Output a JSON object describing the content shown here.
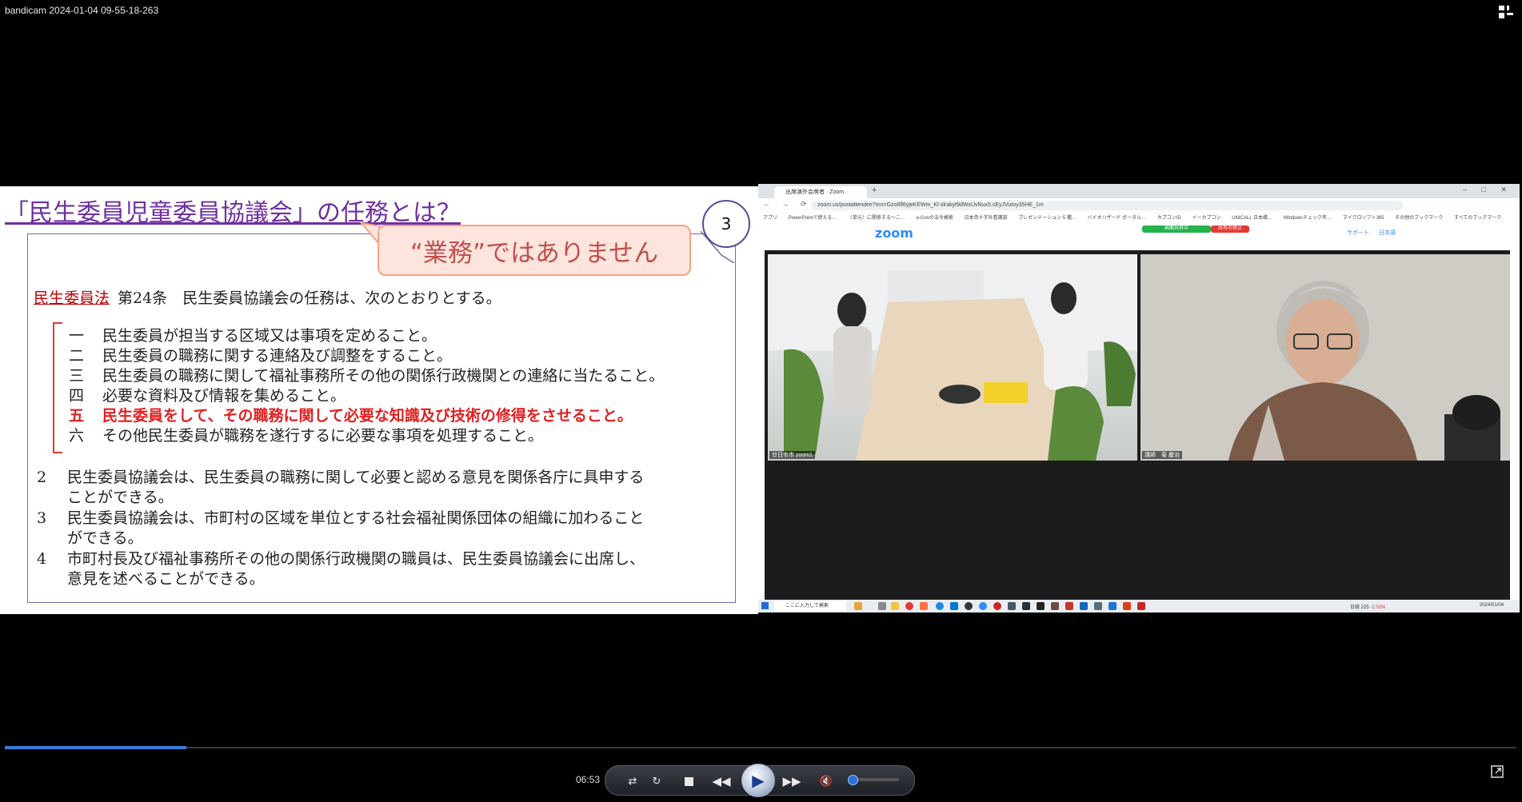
{
  "window": {
    "title": "bandicam 2024-01-04 09-55-18-263"
  },
  "slide": {
    "title": "「民生委員児童委員協議会」の任務とは？",
    "page_number": "3",
    "callout": "“業務”ではありません",
    "law_name": "民生委員法",
    "law_text": "第24条　民生委員協議会の任務は、次のとおりとする。",
    "items": [
      {
        "num": "一",
        "text": "民生委員が担当する区域又は事項を定めること。"
      },
      {
        "num": "二",
        "text": "民生委員の職務に関する連絡及び調整をすること。"
      },
      {
        "num": "三",
        "text": "民生委員の職務に関して福祉事務所その他の関係行政機関との連絡に当たること。"
      },
      {
        "num": "四",
        "text": "必要な資料及び情報を集めること。"
      },
      {
        "num": "五",
        "text": "民生委員をして、その職務に関して必要な知識及び技術の修得をさせること。"
      },
      {
        "num": "六",
        "text": "その他民生委員が職務を遂行するに必要な事項を処理すること。"
      }
    ],
    "paragraphs": [
      {
        "num": "2",
        "line1": "民生委員協議会は、民生委員の職務に関して必要と認める意見を関係各庁に具申する",
        "line2": "ことができる。"
      },
      {
        "num": "3",
        "line1": "民生委員協議会は、市町村の区域を単位とする社会福祉関係団体の組織に加わること",
        "line2": "ができる。"
      },
      {
        "num": "4",
        "line1": "市町村長及び福祉事務所その他の関係行政機関の職員は、民生委員協議会に出席し、",
        "line2": "意見を述べることができる。"
      }
    ]
  },
  "browser": {
    "tab_title": "出席演外会席者 · Zoom",
    "url": "zoom.us/postattendee?mn=Gzo8fl6yjeKEWm_Kl-xlrakyt9dWxUvNux5.sEyJVutoy35HE_1m",
    "bookmarks": [
      "アプリ",
      "PowerPointで使える…",
      "〈単元〉に関係する〜こ…",
      "e-Govの法令検索",
      "日本赤十字社看護部",
      "プレゼンテーション 5 種…",
      "バイオハザード ポータル…",
      "カプコンID",
      "イーカプコン",
      "UNICALL 日本橋…",
      "Windowsチェック年…",
      "マイクロソフト365",
      "その他のブックマーク",
      "すべてのブックマーク"
    ],
    "share_label": "画面共有中",
    "stop_share_label": "共有の停止",
    "zoom_logo": "zoom",
    "support_link": "サポート",
    "language": "日本語",
    "participant_left": "廿日市市 zoom1",
    "participant_right": "講師　菊 慶治",
    "taskbar_search": "ここに入力して検索",
    "taskbar_stock": "日経 225",
    "taskbar_stock_change": "-2.02%",
    "taskbar_date": "2024/01/04"
  },
  "player": {
    "time": "06:53",
    "progress": 0.12,
    "volume": 0.05
  },
  "colors": {
    "slide_title": "#7030a0",
    "red_text": "#e02020",
    "progress": "#3b7dd8",
    "zoom_blue": "#2d8cff"
  }
}
